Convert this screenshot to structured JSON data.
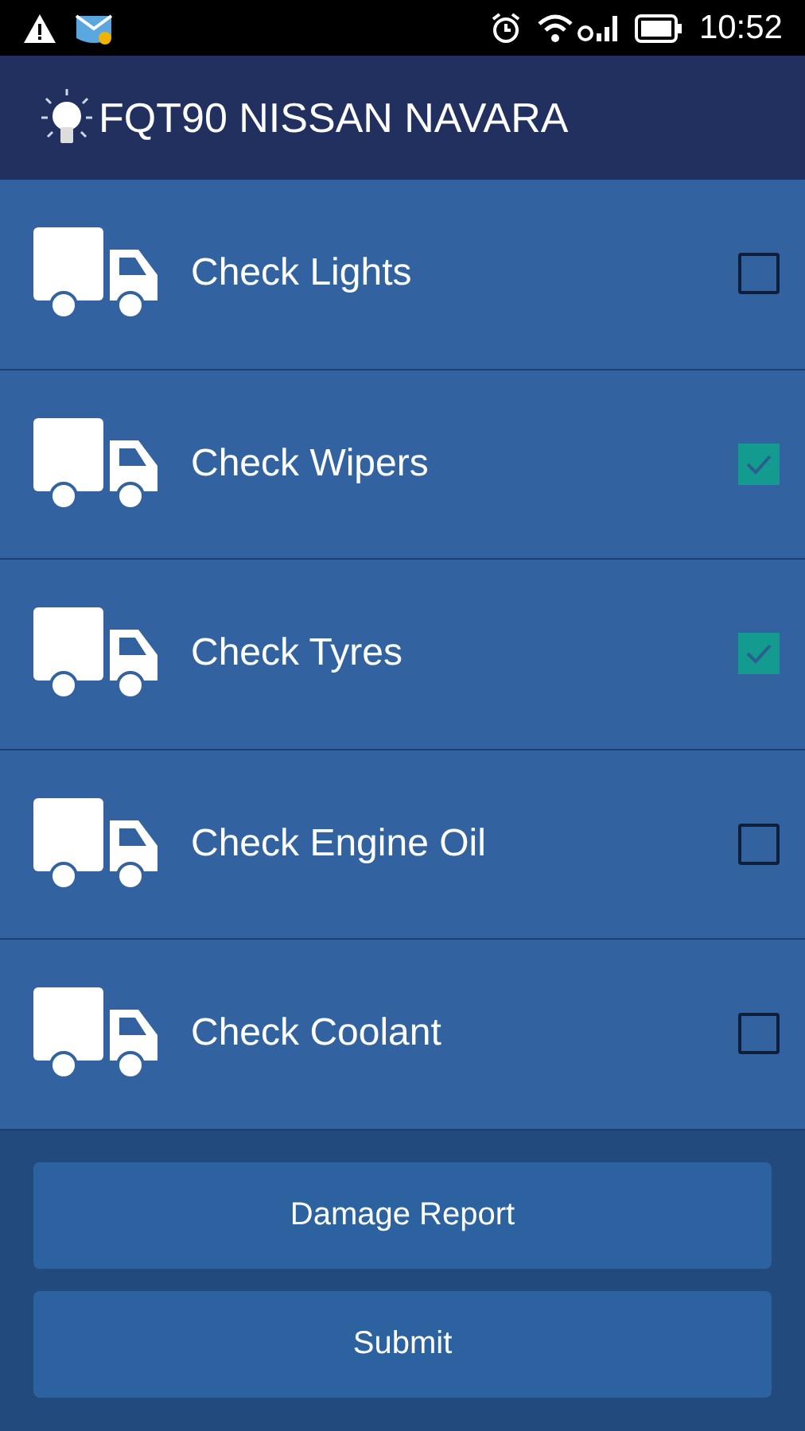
{
  "status_bar": {
    "time": "10:52"
  },
  "app_bar": {
    "title": "FQT90 NISSAN NAVARA"
  },
  "checks": [
    {
      "label": "Check Lights",
      "checked": false
    },
    {
      "label": "Check Wipers",
      "checked": true
    },
    {
      "label": "Check Tyres",
      "checked": true
    },
    {
      "label": "Check Engine Oil",
      "checked": false
    },
    {
      "label": "Check Coolant",
      "checked": false
    }
  ],
  "buttons": [
    "Damage Report",
    "Submit"
  ]
}
